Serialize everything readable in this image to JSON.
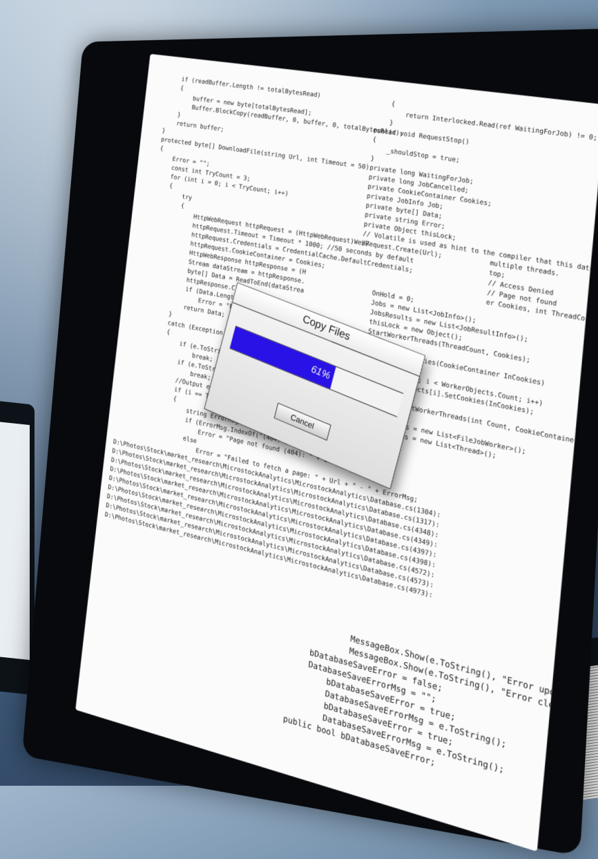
{
  "dialog": {
    "title": "Copy Files",
    "progress_percent": 61,
    "progress_label": "61%",
    "cancel_label": "Cancel"
  },
  "colors": {
    "progress_fill": "#2812e6",
    "keyword": "#1f3fd8",
    "type": "#2b91af",
    "string": "#c4262f",
    "comment": "#2e8b2e"
  },
  "code": {
    "left_lines": [
      "        if (readBuffer.Length != totalBytesRead)",
      "        {",
      "            buffer = new byte[totalBytesRead];",
      "            Buffer.BlockCopy(readBuffer, 0, buffer, 0, totalBytesRead);",
      "        }",
      "        return buffer;",
      "    }",
      "",
      "    protected byte[] DownloadFile(string Url, int Timeout = 50)",
      "    {",
      "        Error = \"\";",
      "        const int TryCount = 3;",
      "        for (int i = 0; i < TryCount; i++)",
      "        {",
      "            try",
      "            {",
      "                HttpWebRequest httpRequest = (HttpWebRequest)WebRequest.Create(Url);",
      "                httpRequest.Timeout = Timeout * 1000; //50 seconds by default",
      "                httpRequest.Credentials = CredentialCache.DefaultCredentials;",
      "                httpRequest.CookieContainer = Cookies;",
      "",
      "                HttpWebResponse httpResponse = (H",
      "",
      "                Stream dataStream = httpResponse.",
      "",
      "                byte[] Data = ReadToEnd(dataStrea",
      "",
      "                httpResponse.Close();",
      "",
      "                if (Data.Length == 0 && !bIgnore",
      "                    Error = \"Empty Page: \" + Url;",
      "",
      "                return Data;",
      "            }",
      "            catch (Exception e)",
      "            {",
      "                if (e.ToString().IndexOf(\"(403)\") != -1 && bIgnoreError403)",
      "                    break;",
      "",
      "                if (e.ToString().IndexOf(\"(404)\") != -1 && bIgnoreError404)",
      "                    break;",
      "",
      "                //Output errors only at last try",
      "                if (i == TryCount - 1)",
      "                {",
      "                    string ErrorMsg = e.ToString();",
      "                    if (ErrorMsg.IndexOf(\"(404)\") != -1)",
      "                        Error = \"Page not found (404): \" + Url;",
      "                    else",
      "                        Error = \"Failed to fetch a page: \" + Url + \" - \" + ErrorMsg;"
    ],
    "paths": [
      "D:\\Photos\\Stock\\market_research\\MicrostockAnalytics\\MicrostockAnalytics\\Database.cs(1304):",
      "D:\\Photos\\Stock\\market_research\\MicrostockAnalytics\\MicrostockAnalytics\\Database.cs(1317):",
      "D:\\Photos\\Stock\\market_research\\MicrostockAnalytics\\MicrostockAnalytics\\Database.cs(4348):",
      "D:\\Photos\\Stock\\market_research\\MicrostockAnalytics\\MicrostockAnalytics\\Database.cs(4349):",
      "D:\\Photos\\Stock\\market_research\\MicrostockAnalytics\\MicrostockAnalytics\\Database.cs(4397):",
      "D:\\Photos\\Stock\\market_research\\MicrostockAnalytics\\MicrostockAnalytics\\Database.cs(4398):",
      "D:\\Photos\\Stock\\market_research\\MicrostockAnalytics\\MicrostockAnalytics\\Database.cs(4572):",
      "D:\\Photos\\Stock\\market_research\\MicrostockAnalytics\\MicrostockAnalytics\\Database.cs(4573):",
      "D:\\Photos\\Stock\\market_research\\MicrostockAnalytics\\MicrostockAnalytics\\Database.cs(4973):"
    ],
    "right_lines": [
      "        {",
      "            return Interlocked.Read(ref WaitingForJob) != 0;",
      "        }",
      "",
      "    public void RequestStop()",
      "    {",
      "        _shouldStop = true;",
      "    }",
      "",
      "    private long WaitingForJob;",
      "    private long JobCancelled;",
      "",
      "    private CookieContainer Cookies;",
      "",
      "    private JobInfo Job;",
      "    private byte[] Data;",
      "    private string Error;",
      "",
      "    private Object thisLock;",
      "",
      "    // Volatile is used as hint to the compiler that this data",
      "    //                               multiple threads.",
      "                                     top;",
      "",
      "                                     // Access Denied",
      "                                     // Page not found",
      "",
      "",
      "",
      "",
      "                                     er Cookies, int ThreadCount)",
      "        OnHold = 0;",
      "        Jobs = new List<JobInfo>();",
      "        JobsResults = new List<JobResultInfo>();",
      "        thisLock = new Object();",
      "        StartWorkerThreads(ThreadCount, Cookies);",
      "    }",
      "",
      "    public void SetCookies(CookieContainer InCookies)",
      "    {",
      "        for (int i = 0; i < WorkerObjects.Count; i++)",
      "            WorkerObjects[i].SetCookies(InCookies);",
      "    }",
      "",
      "    private void StartWorkerThreads(int Count, CookieContainer Cookies)",
      "    {",
      "        WorkerObjects = new List<FileJobWorker>();",
      "        WorkerThreads = new List<Thread>();"
    ],
    "bottom_lines": [
      "                MessageBox.Show(e.ToString(), \"Error updating re",
      "                MessageBox.Show(e.ToString(), \"Error cleaning up",
      "        bDatabaseSaveError = false;",
      "        DatabaseSaveErrorMsg = \"\";",
      "            bDatabaseSaveError = true;",
      "            DatabaseSaveErrorMsg = e.ToString();",
      "            bDatabaseSaveError = true;",
      "            DatabaseSaveErrorMsg = e.ToString();",
      "    public bool bDatabaseSaveError;"
    ]
  }
}
